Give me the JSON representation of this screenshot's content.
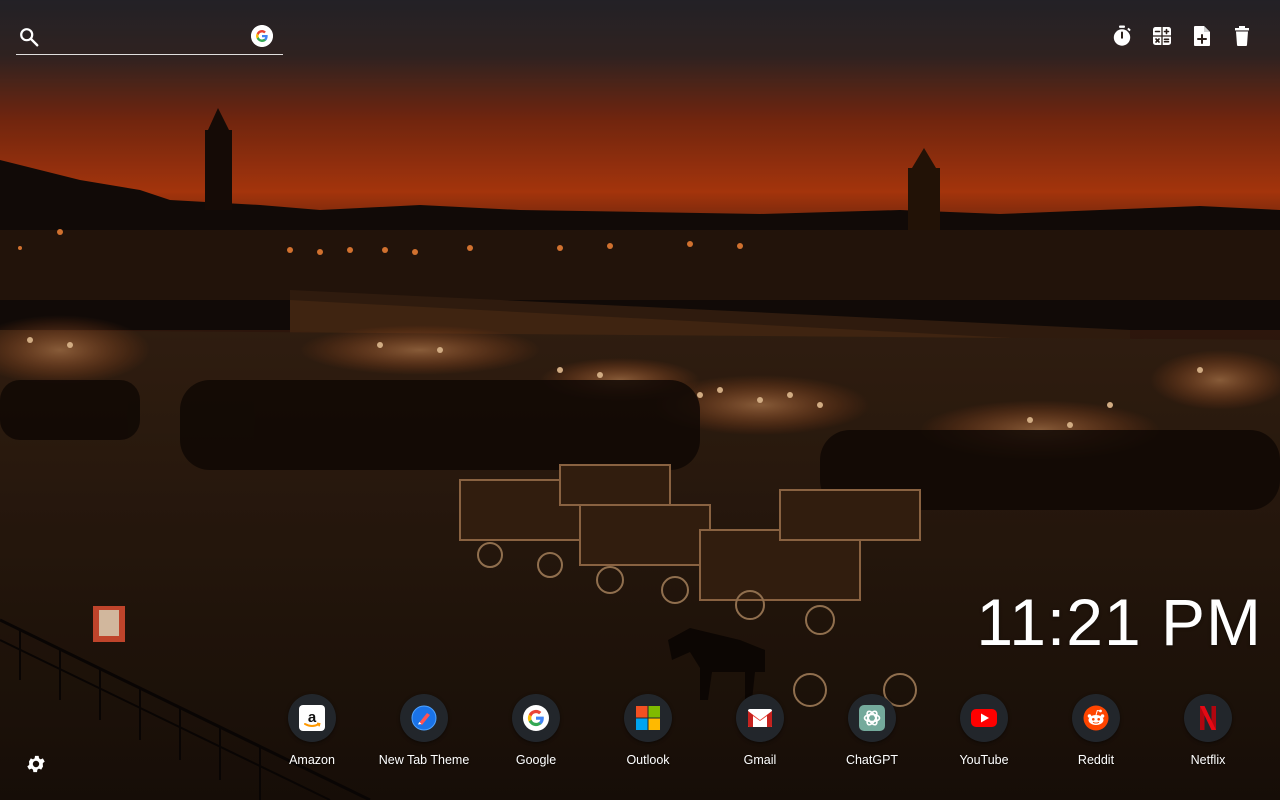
{
  "search": {
    "placeholder": "",
    "value": "",
    "icon": "search-icon",
    "engine_icon": "google-icon"
  },
  "toolbar": {
    "items": [
      {
        "name": "timer",
        "icon": "stopwatch-icon"
      },
      {
        "name": "calculator",
        "icon": "calculator-icon"
      },
      {
        "name": "new-note",
        "icon": "note-add-icon"
      },
      {
        "name": "delete",
        "icon": "trash-icon"
      }
    ]
  },
  "clock": {
    "time": "11:21 PM"
  },
  "shortcuts": [
    {
      "label": "Amazon",
      "icon": "amazon-icon"
    },
    {
      "label": "New Tab Theme",
      "icon": "newtab-theme-icon"
    },
    {
      "label": "Google",
      "icon": "google-icon"
    },
    {
      "label": "Outlook",
      "icon": "microsoft-icon"
    },
    {
      "label": "Gmail",
      "icon": "gmail-icon"
    },
    {
      "label": "ChatGPT",
      "icon": "chatgpt-icon"
    },
    {
      "label": "YouTube",
      "icon": "youtube-icon"
    },
    {
      "label": "Reddit",
      "icon": "reddit-icon"
    },
    {
      "label": "Netflix",
      "icon": "netflix-icon"
    }
  ],
  "settings": {
    "icon": "gear-icon"
  },
  "colors": {
    "sky_top": "#2d2a30",
    "sky_horizon": "#d2400c",
    "ground": "#2a1a10",
    "shortcut_bg": "#22262b",
    "youtube_red": "#ff0000",
    "reddit_orange": "#ff4500",
    "netflix_red": "#e50914",
    "chatgpt_teal": "#74aa9c"
  }
}
